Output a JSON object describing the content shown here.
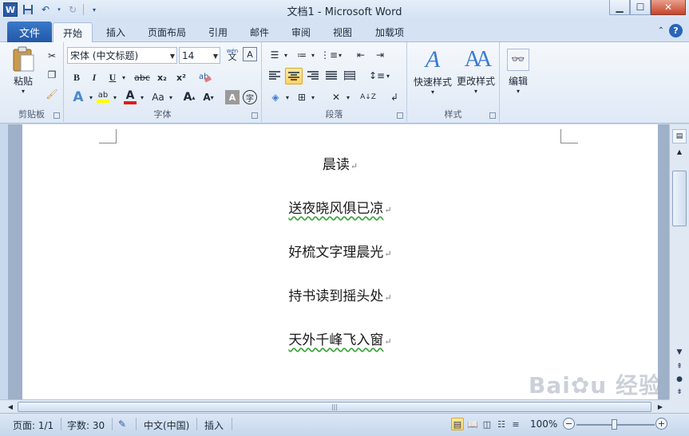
{
  "window": {
    "title": "文档1 - Microsoft Word",
    "app_icon": "word-logo",
    "controls": [
      "minimize",
      "maximize",
      "close"
    ]
  },
  "quick_access": {
    "items": [
      "word-icon",
      "save-icon",
      "undo-icon",
      "redo-icon",
      "customize-icon"
    ]
  },
  "tabs": {
    "file": "文件",
    "items": [
      "开始",
      "插入",
      "页面布局",
      "引用",
      "邮件",
      "审阅",
      "视图",
      "加载项"
    ],
    "active": "开始"
  },
  "ribbon": {
    "clipboard": {
      "label": "剪贴板",
      "paste": "粘贴"
    },
    "font": {
      "label": "字体",
      "font_name": "宋体 (中文标题)",
      "font_size": "14",
      "phonetic_glyph": "wén",
      "bold": "B",
      "italic": "I",
      "underline": "U",
      "strike": "abc",
      "subscript": "x₂",
      "superscript": "x²",
      "grow": "A",
      "shrink": "A",
      "case": "Aa",
      "color": "A"
    },
    "paragraph": {
      "label": "段落",
      "sort": "A↓Z"
    },
    "styles": {
      "label": "样式",
      "quick": "快速样式",
      "change": "更改样式"
    },
    "editing": {
      "label": "编辑"
    }
  },
  "document": {
    "paragraphs": [
      "晨读",
      "送夜晓风俱已凉",
      "好梳文字理晨光",
      "持书读到摇头处",
      "天外千峰飞入窗"
    ],
    "paragraph_mark": "↵"
  },
  "statusbar": {
    "page": "页面: 1/1",
    "words": "字数: 30",
    "language": "中文(中国)",
    "mode": "插入",
    "zoom": "100%",
    "zoom_level_fraction": 0.5
  },
  "colors": {
    "accent": "#2358a8",
    "ribbon_bg": "#dfe9f5",
    "selected_button": "#ffd35c",
    "spell_squiggle": "#3ba53b"
  }
}
